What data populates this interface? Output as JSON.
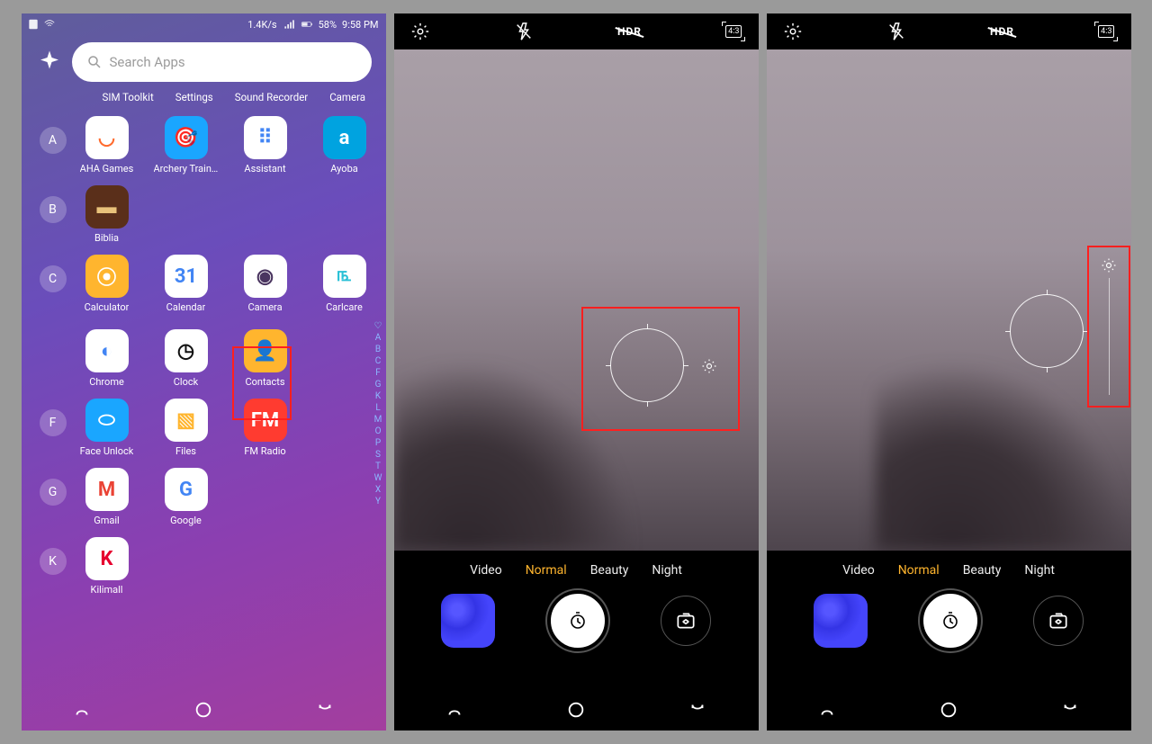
{
  "status": {
    "rate": "1.4K/s",
    "battery": "58%",
    "time": "9:58 PM"
  },
  "search": {
    "placeholder": "Search Apps"
  },
  "shortcuts": [
    "SIM Toolkit",
    "Settings",
    "Sound Recorder",
    "Camera"
  ],
  "sections": [
    {
      "letter": "A",
      "apps": [
        {
          "label": "AHA Games",
          "bg": "#fff",
          "fg": "#ff6b2e",
          "glyph": "◡"
        },
        {
          "label": "Archery Traini...",
          "bg": "#1aa6ff",
          "fg": "#fff",
          "glyph": "🎯"
        },
        {
          "label": "Assistant",
          "bg": "#fff",
          "fg": "#4285f4",
          "glyph": "⠿"
        },
        {
          "label": "Ayoba",
          "bg": "#00a3e0",
          "fg": "#fff",
          "glyph": "a"
        }
      ]
    },
    {
      "letter": "B",
      "apps": [
        {
          "label": "Biblia",
          "bg": "#5a2f1a",
          "fg": "#e9c27a",
          "glyph": "▬"
        }
      ]
    },
    {
      "letter": "C",
      "apps": [
        {
          "label": "Calculator",
          "bg": "#ffb52e",
          "fg": "#fff",
          "glyph": "⦿"
        },
        {
          "label": "Calendar",
          "bg": "#fff",
          "fg": "#4285f4",
          "glyph": "31"
        },
        {
          "label": "Camera",
          "bg": "#fff",
          "fg": "#4a3560",
          "glyph": "◉"
        },
        {
          "label": "Carlcare",
          "bg": "#fff",
          "fg": "#29c0d6",
          "glyph": "௩"
        },
        {
          "label": "Chrome",
          "bg": "#fff",
          "fg": "#4285f4",
          "glyph": "◐"
        },
        {
          "label": "Clock",
          "bg": "#fff",
          "fg": "#111",
          "glyph": "◷"
        },
        {
          "label": "Contacts",
          "bg": "#ffb52e",
          "fg": "#fff",
          "glyph": "👤"
        }
      ]
    },
    {
      "letter": "F",
      "apps": [
        {
          "label": "Face Unlock",
          "bg": "#1aa6ff",
          "fg": "#fff",
          "glyph": "⬭"
        },
        {
          "label": "Files",
          "bg": "#fff",
          "fg": "#ffb52e",
          "glyph": "▧"
        },
        {
          "label": "FM Radio",
          "bg": "#ff3b30",
          "fg": "#fff",
          "glyph": "FM"
        }
      ]
    },
    {
      "letter": "G",
      "apps": [
        {
          "label": "Gmail",
          "bg": "#fff",
          "fg": "#ea4335",
          "glyph": "M"
        },
        {
          "label": "Google",
          "bg": "#fff",
          "fg": "#4285f4",
          "glyph": "G"
        }
      ]
    },
    {
      "letter": "K",
      "apps": [
        {
          "label": "Kilimall",
          "bg": "#fff",
          "fg": "#e6002e",
          "glyph": "K"
        }
      ]
    }
  ],
  "index": [
    "♡",
    "A",
    "B",
    "C",
    "F",
    "G",
    "K",
    "L",
    "M",
    "O",
    "P",
    "S",
    "T",
    "W",
    "X",
    "Y"
  ],
  "camera": {
    "hdr": "HDR",
    "aspect": "4:3",
    "modes": [
      "Video",
      "Normal",
      "Beauty",
      "Night"
    ],
    "active_mode": "Normal"
  }
}
